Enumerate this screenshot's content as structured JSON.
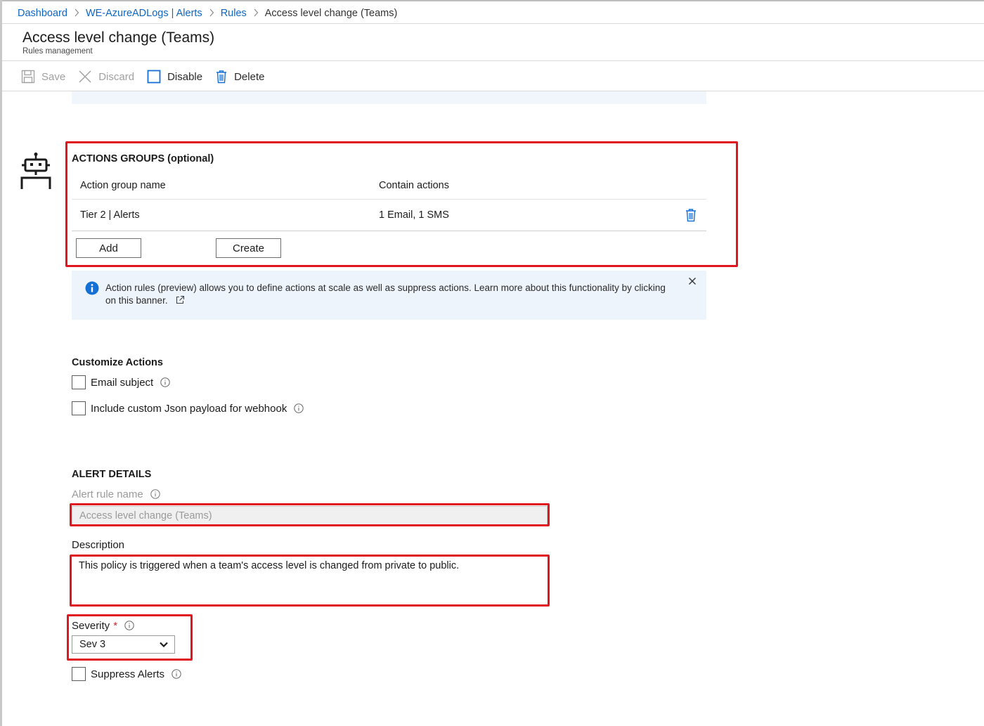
{
  "breadcrumb": {
    "items": [
      "Dashboard",
      "WE-AzureADLogs | Alerts",
      "Rules"
    ],
    "current": "Access level change (Teams)"
  },
  "page": {
    "title": "Access level change (Teams)",
    "subtitle": "Rules management"
  },
  "toolbar": {
    "save": "Save",
    "discard": "Discard",
    "disable": "Disable",
    "delete": "Delete"
  },
  "action_groups": {
    "heading": "ACTIONS GROUPS (optional)",
    "columns": [
      "Action group name",
      "Contain actions"
    ],
    "rows": [
      {
        "name": "Tier 2 | Alerts",
        "actions": "1 Email, 1 SMS"
      }
    ],
    "add_label": "Add",
    "create_label": "Create"
  },
  "banner": {
    "text": "Action rules (preview) allows you to define actions at scale as well as suppress actions. Learn more about this functionality by clicking on this banner."
  },
  "customize": {
    "heading": "Customize Actions",
    "email_subject": "Email subject",
    "custom_json": "Include custom Json payload for webhook"
  },
  "alert_details": {
    "heading": "ALERT DETAILS",
    "rule_name_label": "Alert rule name",
    "rule_name_value": "Access level change (Teams)",
    "description_label": "Description",
    "description_value": "This policy is triggered when a team's access level is changed from private to public.",
    "severity_label": "Severity",
    "severity_required": "*",
    "severity_value": "Sev 3",
    "suppress_label": "Suppress Alerts"
  },
  "colors": {
    "link": "#0e66c4",
    "highlight": "#e0151d",
    "banner_bg": "#eef4fb",
    "info_blue": "#1570d6"
  },
  "icons": [
    "chevron-right-icon",
    "save-icon",
    "close-icon",
    "checkbox-icon",
    "trash-icon",
    "robot-icon",
    "info-icon",
    "external-link-icon",
    "info-circle-icon",
    "chevron-down-icon"
  ]
}
